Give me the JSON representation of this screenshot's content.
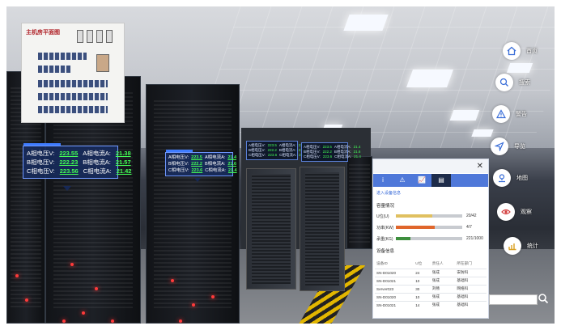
{
  "minimap": {
    "title": "主机房平面图"
  },
  "tag_left": {
    "rows": [
      {
        "a_label": "A相电压V:",
        "a_val": "223.55",
        "b_label": "A相电流A:",
        "b_val": "21.38"
      },
      {
        "a_label": "B相电压V:",
        "a_val": "222.23",
        "b_label": "B相电流A:",
        "b_val": "21.57"
      },
      {
        "a_label": "C相电压V:",
        "a_val": "223.56",
        "b_label": "C相电流A:",
        "b_val": "21.42"
      }
    ]
  },
  "tag_mid": {
    "rows": [
      {
        "a_label": "A相电压V:",
        "a_val": "223.5",
        "b_label": "A相电流A:",
        "b_val": "21.4"
      },
      {
        "a_label": "B相电压V:",
        "a_val": "222.2",
        "b_label": "B相电流A:",
        "b_val": "21.6"
      },
      {
        "a_label": "C相电压V:",
        "a_val": "223.6",
        "b_label": "C相电流A:",
        "b_val": "21.4"
      }
    ]
  },
  "panel": {
    "tabs": [
      "i",
      "⚠",
      "📈",
      "▤"
    ],
    "link": "进入设备信息",
    "section_capacity": "容量情况",
    "bars": [
      {
        "label": "U位(U)",
        "pct": 55,
        "color": "#e0c060",
        "value": "20/42"
      },
      {
        "label": "功率(KW)",
        "pct": 58,
        "color": "#e0662b",
        "value": "4/7"
      },
      {
        "label": "承重(KG)",
        "pct": 22,
        "color": "#3e8f3e",
        "value": "221/1000"
      }
    ],
    "section_devices": "设备信息",
    "columns": [
      "设备ID",
      "U位",
      "责任人",
      "所在部门"
    ],
    "rows": [
      [
        "SN-D01020",
        "24",
        "张成",
        "安防科"
      ],
      [
        "SN-D01021",
        "10",
        "张成",
        "基础科"
      ],
      [
        "Server023",
        "30",
        "刘畅",
        "网络科"
      ],
      [
        "SN-D01020",
        "10",
        "张成",
        "基础科"
      ],
      [
        "SN-D01021",
        "14",
        "张成",
        "基础科"
      ]
    ]
  },
  "nav": [
    {
      "label": "首页",
      "icon": "home-icon"
    },
    {
      "label": "搜索",
      "icon": "search-icon"
    },
    {
      "label": "警告",
      "icon": "warning-icon"
    },
    {
      "label": "导览",
      "icon": "navigate-icon"
    },
    {
      "label": "地图",
      "icon": "map-pin-icon"
    },
    {
      "label": "观察",
      "icon": "eye-icon"
    },
    {
      "label": "统计",
      "icon": "chart-icon"
    }
  ],
  "search": {
    "placeholder": ""
  }
}
